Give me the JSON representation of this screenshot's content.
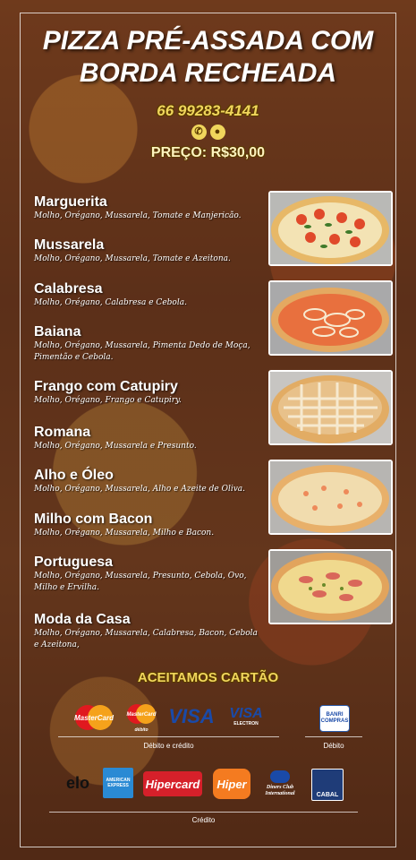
{
  "header": {
    "title_line1": "PIZZA PRÉ-ASSADA COM",
    "title_line2": "BORDA RECHEADA",
    "phone": "66 99283-4141",
    "phone_icon": "phone-icon",
    "whatsapp_icon": "whatsapp-icon",
    "price": "PREÇO: R$30,00"
  },
  "menu": [
    {
      "name": "Marguerita",
      "desc": "Molho, Orégano, Mussarela, Tomate e Manjericão."
    },
    {
      "name": "Mussarela",
      "desc": "Molho, Orégano, Mussarela, Tomate e Azeitona."
    },
    {
      "name": "Calabresa",
      "desc": "Molho, Orégano, Calabresa e Cebola."
    },
    {
      "name": "Baiana",
      "desc": "Molho, Orégano, Mussarela, Pimenta Dedo de Moça, Pimentão e Cebola."
    },
    {
      "name": "Frango com Catupiry",
      "desc": "Molho, Orégano, Frango e Catupiry."
    },
    {
      "name": "Romana",
      "desc": "Molho, Orégano, Mussarela e Presunto."
    },
    {
      "name": "Alho e Óleo",
      "desc": "Molho, Orégano, Mussarela, Alho e Azeite de Oliva."
    },
    {
      "name": "Milho com Bacon",
      "desc": "Molho, Orégano, Mussarela, Milho e Bacon."
    },
    {
      "name": "Portuguesa",
      "desc": "Molho, Orégano, Mussarela, Presunto, Cebola, Ovo, Milho e Ervilha."
    },
    {
      "name": "Moda da Casa",
      "desc": "Molho, Orégano, Mussarela, Calabresa, Bacon, Cebola e Azeitona,"
    }
  ],
  "payment": {
    "title": "ACEITAMOS CARTÃO",
    "debit_credit_label": "Débito e crédito",
    "debit_label": "Débito",
    "credit_label": "Crédito",
    "cards": {
      "mastercard": "MasterCard",
      "maestro": "MasterCard",
      "maestro_sub": "débito",
      "visa": "VISA",
      "visa_electron": "VISA",
      "visa_electron_sub": "ELECTRON",
      "banricompras": "BANRI COMPRAS",
      "elo": "elo",
      "amex": "AMERICAN EXPRESS",
      "hipercard": "Hipercard",
      "hiper": "Hiper",
      "diners": "Diners Club International",
      "cabal": "CABAL"
    }
  },
  "colors": {
    "accent_gold": "#f0d65c",
    "text": "#ffffff"
  }
}
